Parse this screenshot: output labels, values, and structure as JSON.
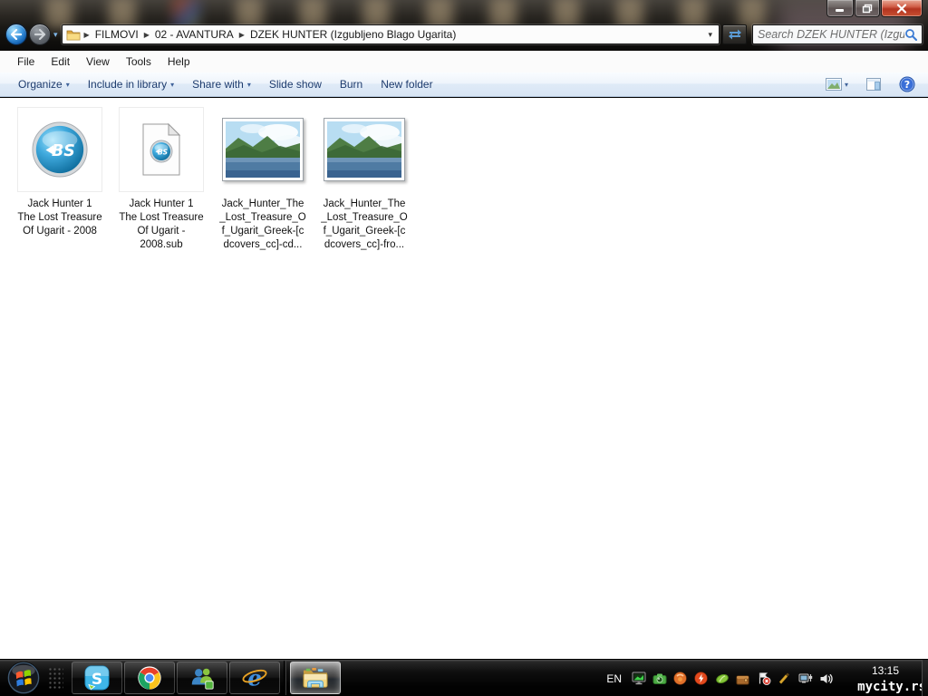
{
  "window": {
    "app": "Windows Explorer",
    "controls": [
      "minimize",
      "restore",
      "close"
    ]
  },
  "navigation": {
    "breadcrumbs": [
      "FILMOVI",
      "02 - AVANTURA",
      "DZEK HUNTER (Izgubljeno Blago Ugarita)"
    ],
    "search_placeholder": "Search DZEK HUNTER (Izgu..."
  },
  "menu_bar": {
    "items": [
      "File",
      "Edit",
      "View",
      "Tools",
      "Help"
    ]
  },
  "toolbar": {
    "items": [
      {
        "label": "Organize",
        "dropdown": true
      },
      {
        "label": "Include in library",
        "dropdown": true
      },
      {
        "label": "Share with",
        "dropdown": true
      },
      {
        "label": "Slide show",
        "dropdown": false
      },
      {
        "label": "Burn",
        "dropdown": false
      },
      {
        "label": "New folder",
        "dropdown": false
      }
    ],
    "right_icons": [
      "views",
      "preview-pane",
      "help"
    ]
  },
  "files": [
    {
      "name": "Jack Hunter 1 The Lost Treasure Of Ugarit - 2008",
      "display_lines": [
        "Jack Hunter 1",
        "The Lost Treasure",
        "Of Ugarit - 2008"
      ],
      "type": "bsplayer-media"
    },
    {
      "name": "Jack Hunter 1 The Lost Treasure Of Ugarit - 2008.sub",
      "display_lines": [
        "Jack Hunter 1",
        "The Lost Treasure",
        "Of Ugarit -",
        "2008.sub"
      ],
      "type": "bsplayer-subtitle"
    },
    {
      "name": "Jack_Hunter_The_Lost_Treasure_Of_Ugarit_Greek-[cdcovers_cc]-cd...",
      "display_lines": [
        "Jack_Hunter_The",
        "_Lost_Treasure_O",
        "f_Ugarit_Greek-[c",
        "dcovers_cc]-cd..."
      ],
      "type": "photo"
    },
    {
      "name": "Jack_Hunter_The_Lost_Treasure_Of_Ugarit_Greek-[cdcovers_cc]-fro...",
      "display_lines": [
        "Jack_Hunter_The",
        "_Lost_Treasure_O",
        "f_Ugarit_Greek-[c",
        "dcovers_cc]-fro..."
      ],
      "type": "photo"
    }
  ],
  "taskbar": {
    "apps": [
      {
        "name": "skype",
        "active": false
      },
      {
        "name": "chrome",
        "active": false
      },
      {
        "name": "messenger",
        "active": false
      },
      {
        "name": "internet-explorer",
        "active": false
      },
      {
        "name": "windows-explorer",
        "active": true,
        "separator_before": true
      }
    ],
    "tray": {
      "language": "EN",
      "icons": [
        "monitor",
        "camera",
        "orange-ball",
        "flash",
        "leaf",
        "pouch",
        "action-center",
        "brush",
        "network",
        "volume"
      ],
      "time": "13:15",
      "watermark": "mycity.rs"
    }
  },
  "colors": {
    "toolbar_text": "#1e3c6e",
    "close_button_red": "#b33420",
    "taskbar_black": "#050505",
    "accent_blue": "#3b7bd4"
  }
}
